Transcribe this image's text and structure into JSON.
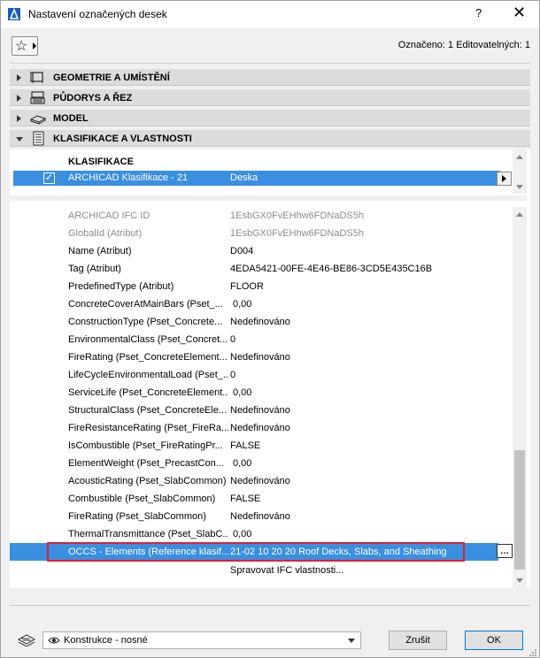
{
  "window": {
    "title": "Nastavení označených desek",
    "help": "?",
    "close": "✕"
  },
  "header": {
    "selection_info": "Označeno: 1 Editovatelných: 1"
  },
  "sections": [
    {
      "label": "GEOMETRIE A UMÍSTĚNÍ",
      "expanded": false,
      "icon": "geometry-icon"
    },
    {
      "label": "PŮDORYS A ŘEZ",
      "expanded": false,
      "icon": "floor-plan-icon"
    },
    {
      "label": "MODEL",
      "expanded": false,
      "icon": "model-icon"
    },
    {
      "label": "KLASIFIKACE A VLASTNOSTI",
      "expanded": true,
      "icon": "classification-icon"
    }
  ],
  "classification": {
    "heading": "KLASIFIKACE",
    "row": {
      "checked": true,
      "name": "ARCHICAD Klasifikace - 21",
      "value": "Deska"
    }
  },
  "properties": [
    {
      "name": "ARCHICAD IFC ID",
      "value": "1EsbGX0FvEHhw6FDNaDS5h",
      "dim": true
    },
    {
      "name": "GlobalId (Atribut)",
      "value": "1EsbGX0FvEHhw6FDNaDS5h",
      "dim": true
    },
    {
      "name": "Name (Atribut)",
      "value": "D004"
    },
    {
      "name": "Tag (Atribut)",
      "value": "4EDA5421-00FE-4E46-BE86-3CD5E435C16B"
    },
    {
      "name": "PredefinedType (Atribut)",
      "value": "FLOOR"
    },
    {
      "name": "ConcreteCoverAtMainBars (Pset_...",
      "value": "0,00"
    },
    {
      "name": "ConstructionType (Pset_Concrete...",
      "value": "Nedefinováno"
    },
    {
      "name": "EnvironmentalClass (Pset_Concret...",
      "value": "0"
    },
    {
      "name": "FireRating (Pset_ConcreteElement...",
      "value": "Nedefinováno"
    },
    {
      "name": "LifeCycleEnvironmentalLoad (Pset_...",
      "value": "0"
    },
    {
      "name": "ServiceLife (Pset_ConcreteElement...",
      "value": "0,00"
    },
    {
      "name": "StructuralClass (Pset_ConcreteEle...",
      "value": "Nedefinováno"
    },
    {
      "name": "FireResistanceRating (Pset_FireRa...",
      "value": "Nedefinováno"
    },
    {
      "name": "IsCombustible (Pset_FireRatingPr...",
      "value": "FALSE"
    },
    {
      "name": "ElementWeight (Pset_PrecastCon...",
      "value": "0,00"
    },
    {
      "name": "AcousticRating (Pset_SlabCommon)",
      "value": "Nedefinováno"
    },
    {
      "name": "Combustible (Pset_SlabCommon)",
      "value": "FALSE"
    },
    {
      "name": "FireRating (Pset_SlabCommon)",
      "value": "Nedefinováno"
    },
    {
      "name": "ThermalTransmittance (Pset_SlabC...",
      "value": "0,00"
    },
    {
      "name": "OCCS - Elements (Reference klasif...",
      "value": "21-02 10 20 20 Roof Decks, Slabs, and Sheathing",
      "selected": true
    }
  ],
  "manage_link": "Spravovat IFC vlastnosti...",
  "footer": {
    "layer_value": "Konstrukce - nosné",
    "cancel_label": "Zrušit",
    "ok_label": "OK"
  },
  "colors": {
    "selection": "#3a8fe0",
    "highlight_box": "#e0212e",
    "section_bg": "#dcdcdc"
  }
}
